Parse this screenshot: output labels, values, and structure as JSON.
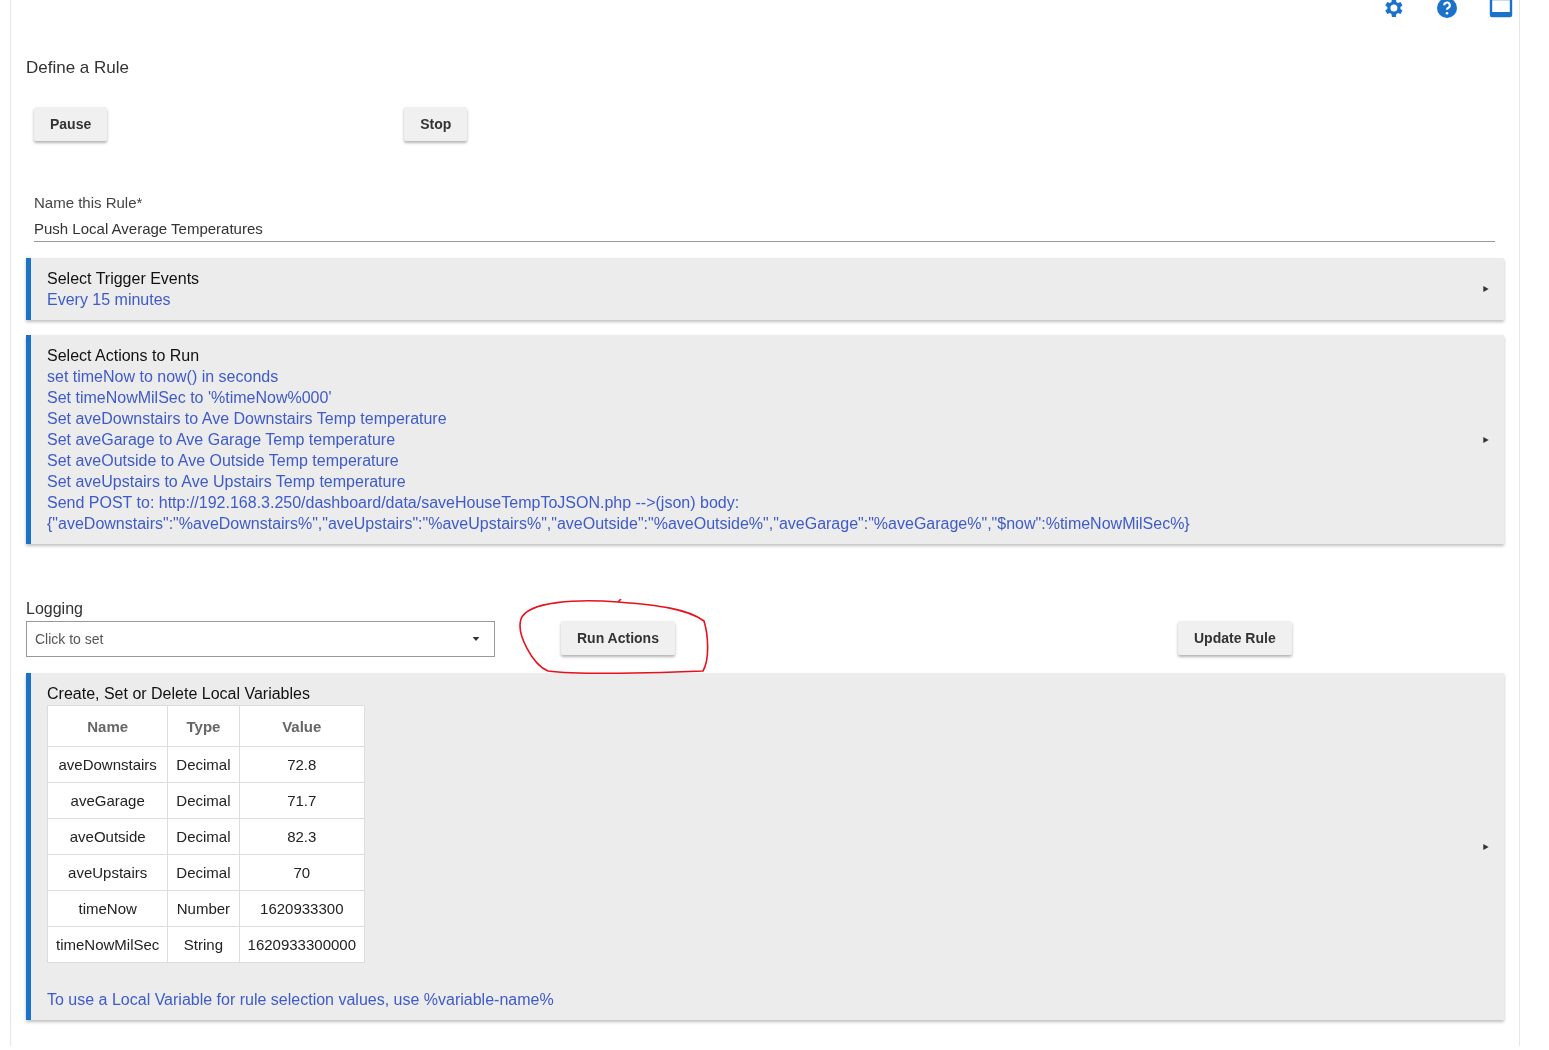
{
  "header_icons": [
    {
      "kind": "settings"
    },
    {
      "kind": "help"
    },
    {
      "kind": "window"
    }
  ],
  "title": "Define a Rule",
  "top_buttons": [
    "Pause",
    "Stop"
  ],
  "name_field": {
    "label": "Name this Rule*",
    "value": "Push Local Average Temperatures"
  },
  "trigger_section": {
    "title": "Select Trigger Events",
    "lines": [
      "Every 15 minutes"
    ]
  },
  "actions_section": {
    "title": "Select Actions to Run",
    "lines": [
      "set timeNow to now() in seconds",
      "Set timeNowMilSec to '%timeNow%000'",
      "Set aveDownstairs to Ave Downstairs Temp temperature",
      "Set aveGarage to Ave Garage Temp temperature",
      "Set aveOutside to Ave Outside Temp temperature",
      "Set aveUpstairs to Ave Upstairs Temp temperature",
      "Send POST to: http://192.168.3.250/dashboard/data/saveHouseTempToJSON.php -->(json) body:",
      "{\"aveDownstairs\":\"%aveDownstairs%\",\"aveUpstairs\":\"%aveUpstairs%\",\"aveOutside\":\"%aveOutside%\",\"aveGarage\":\"%aveGarage%\",\"$now\":%timeNowMilSec%}"
    ]
  },
  "logging": {
    "label": "Logging",
    "placeholder": "Click to set"
  },
  "run_actions_button": {
    "label": "Run Actions",
    "circled": true
  },
  "update_button": "Update Rule",
  "variables_section": {
    "title": "Create, Set or Delete Local Variables",
    "table": {
      "columns": [
        "Name",
        "Type",
        "Value"
      ],
      "rows": [
        [
          "aveDownstairs",
          "Decimal",
          "72.8"
        ],
        [
          "aveGarage",
          "Decimal",
          "71.7"
        ],
        [
          "aveOutside",
          "Decimal",
          "82.3"
        ],
        [
          "aveUpstairs",
          "Decimal",
          "70"
        ],
        [
          "timeNow",
          "Number",
          "1620933300"
        ],
        [
          "timeNowMilSec",
          "String",
          "1620933300000"
        ]
      ]
    },
    "note": "To use a Local Variable for rule selection values, use %variable-name%"
  }
}
